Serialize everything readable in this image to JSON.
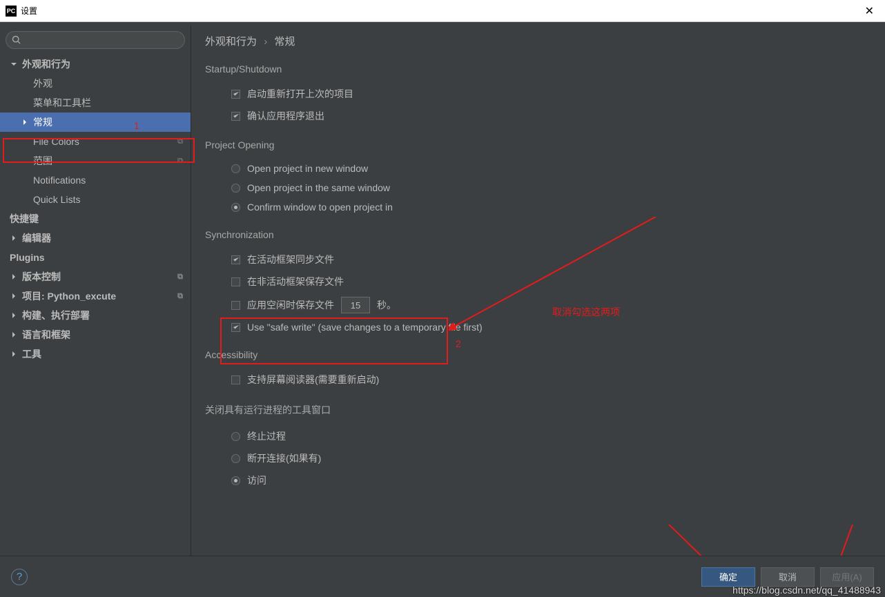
{
  "window": {
    "title": "设置"
  },
  "breadcrumb": {
    "root": "外观和行为",
    "sep": "›",
    "leaf": "常规"
  },
  "sidebar": {
    "items": [
      {
        "label": "外观和行为",
        "expandable": true,
        "expanded": true,
        "bold": true
      },
      {
        "label": "外观",
        "child": true
      },
      {
        "label": "菜单和工具栏",
        "child": true
      },
      {
        "label": "常规",
        "child": true,
        "hasArrow": true,
        "selected": true
      },
      {
        "label": "File Colors",
        "child": true,
        "tag": true
      },
      {
        "label": "范围",
        "child": true,
        "tag": true
      },
      {
        "label": "Notifications",
        "child": true
      },
      {
        "label": "Quick Lists",
        "child": true
      },
      {
        "label": "快捷键",
        "bold": true
      },
      {
        "label": "编辑器",
        "expandable": true,
        "bold": true
      },
      {
        "label": "Plugins",
        "bold": true
      },
      {
        "label": "版本控制",
        "expandable": true,
        "bold": true,
        "tag": true
      },
      {
        "label": "项目: Python_excute",
        "expandable": true,
        "bold": true,
        "tag": true
      },
      {
        "label": "构建、执行部署",
        "expandable": true,
        "bold": true
      },
      {
        "label": "语言和框架",
        "expandable": true,
        "bold": true
      },
      {
        "label": "工具",
        "expandable": true,
        "bold": true
      }
    ]
  },
  "sections": {
    "startup": {
      "title": "Startup/Shutdown",
      "opt1": "启动重新打开上次的项目",
      "opt2": "确认应用程序退出"
    },
    "projectOpening": {
      "title": "Project Opening",
      "r1": "Open project in new window",
      "r2": "Open project in the same window",
      "r3": "Confirm window to open project in"
    },
    "sync": {
      "title": "Synchronization",
      "c1": "在活动框架同步文件",
      "c2": "在非活动框架保存文件",
      "c3": "应用空闲时保存文件",
      "seconds_value": "15",
      "seconds_suffix": "秒。",
      "c4": "Use \"safe write\" (save changes to a temporary file first)"
    },
    "accessibility": {
      "title": "Accessibility",
      "c1": "支持屏幕阅读器(需要重新启动)"
    },
    "closing": {
      "title": "关闭具有运行进程的工具窗口",
      "r1": "终止过程",
      "r2": "断开连接(如果有)",
      "r3": "访问"
    }
  },
  "footer": {
    "ok": "确定",
    "cancel": "取消",
    "apply": "应用(A)"
  },
  "annotations": {
    "label1": "1",
    "label2": "2",
    "uncheck_text": "取消勾选这两项",
    "watermark": "https://blog.csdn.net/qq_41488943"
  }
}
